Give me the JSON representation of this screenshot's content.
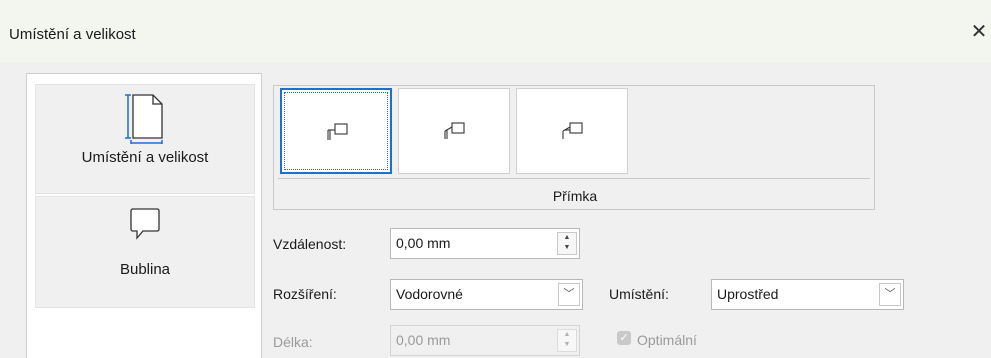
{
  "window": {
    "title": "Umístění a velikost",
    "close_glyph": "✕"
  },
  "nav": {
    "items": [
      {
        "label": "Umístění a velikost",
        "icon": "page-size-icon",
        "selected": true
      },
      {
        "label": "Bublina",
        "icon": "speech-bubble-icon",
        "selected": false
      }
    ]
  },
  "preview": {
    "caption": "Přímka",
    "tiles": [
      {
        "icon": "callout-line-style-1-icon",
        "selected": true
      },
      {
        "icon": "callout-line-style-2-icon",
        "selected": false
      },
      {
        "icon": "callout-line-style-3-icon",
        "selected": false
      }
    ]
  },
  "form": {
    "distance": {
      "label": "Vzdálenost:",
      "value": "0,00 mm"
    },
    "extension": {
      "label": "Rozšíření:",
      "value": "Vodorovné"
    },
    "position": {
      "label": "Umístění:",
      "value": "Uprostřed"
    },
    "length": {
      "label": "Délka:",
      "value": "0,00 mm",
      "disabled": true
    },
    "optimal": {
      "label": "Optimální",
      "checked": true,
      "disabled": true
    }
  },
  "icons": {
    "spin_up": "▲",
    "spin_down": "▼",
    "dropdown": "﹀",
    "check": "✓"
  }
}
